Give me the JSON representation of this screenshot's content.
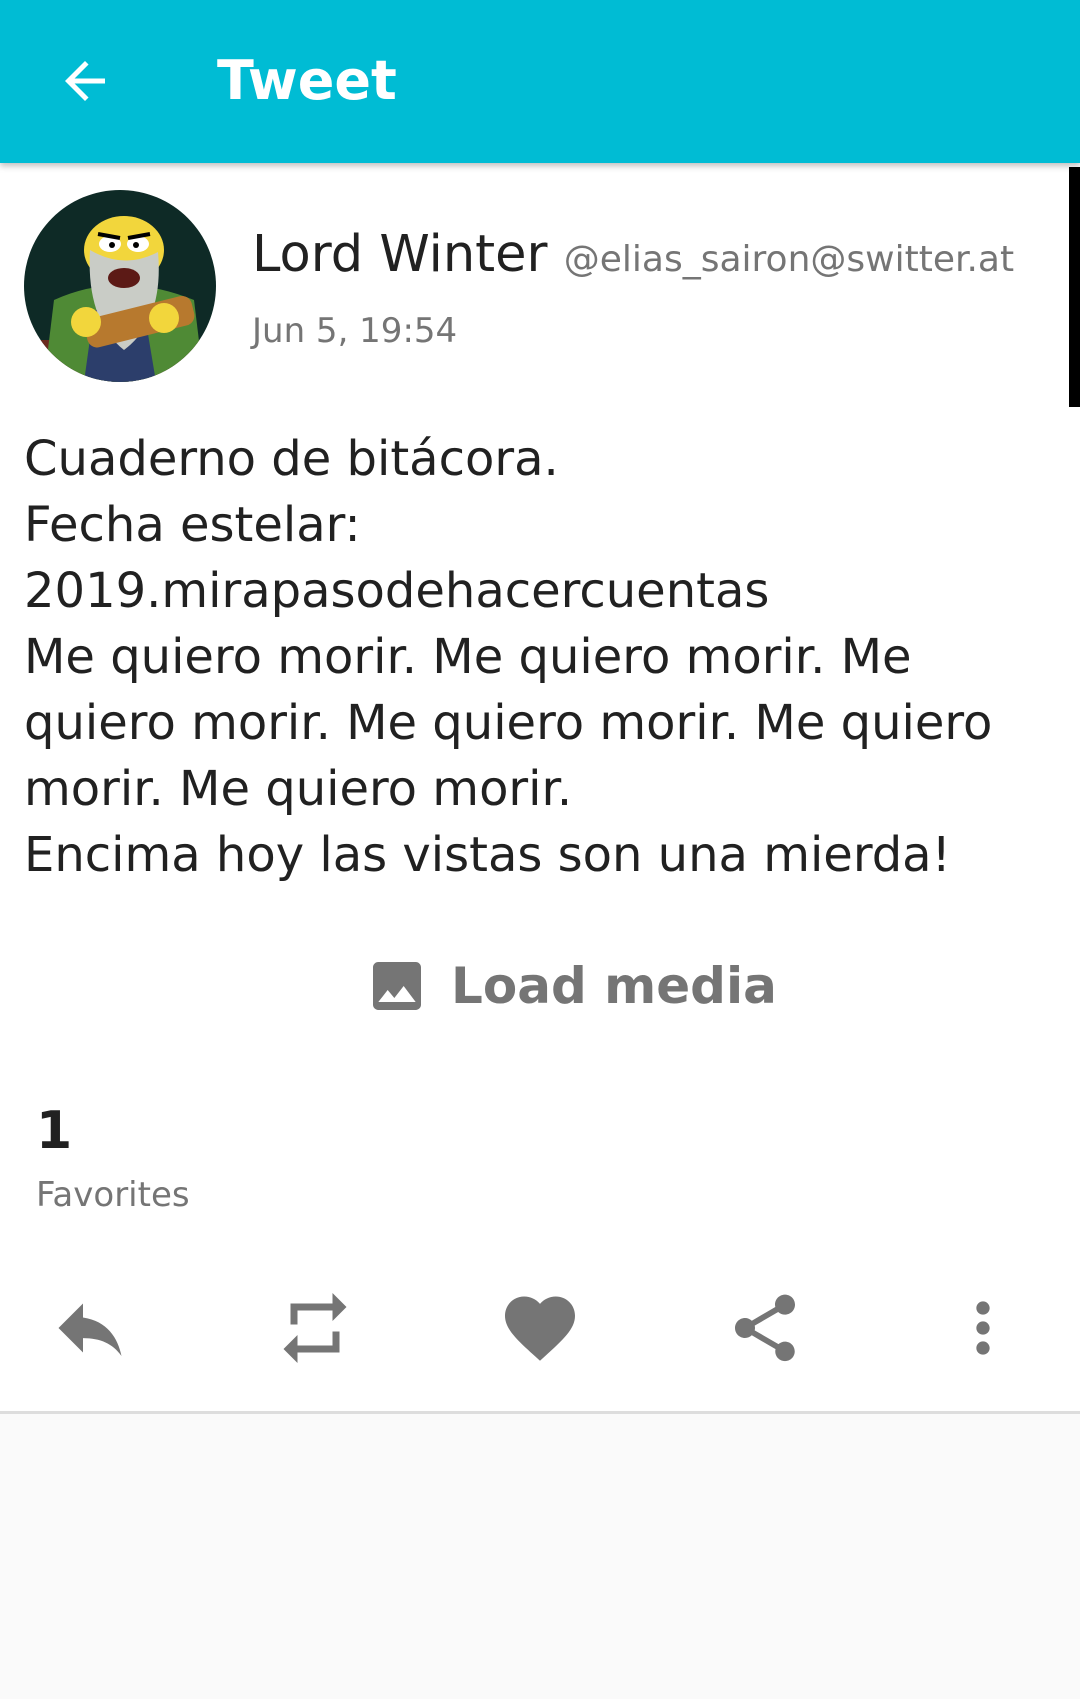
{
  "theme": {
    "accent": "#00bcd4",
    "icon_gray": "#757575"
  },
  "appbar": {
    "back_icon": "arrow-left-icon",
    "title": "Tweet"
  },
  "tweet": {
    "author": {
      "display_name": "Lord Winter",
      "handle": "@elias_sairon@switter.at",
      "avatar": "bearded-man-avatar"
    },
    "timestamp": "Jun 5, 19:54",
    "text_lines": [
      "Cuaderno de bitácora.",
      "Fecha estelar:",
      "2019.mirapasodehacercuentas",
      "Me quiero morir. Me quiero morir. Me",
      "quiero morir. Me quiero morir. Me quiero",
      "morir. Me quiero morir.",
      "Encima hoy las vistas son una mierda!"
    ],
    "load_media": {
      "icon": "image-icon",
      "label": "Load media"
    },
    "stats": {
      "favorites_count": "1",
      "favorites_label": "Favorites"
    },
    "actions": [
      {
        "name": "reply",
        "icon": "reply-icon"
      },
      {
        "name": "retweet",
        "icon": "retweet-icon"
      },
      {
        "name": "favorite",
        "icon": "heart-icon"
      },
      {
        "name": "share",
        "icon": "share-icon"
      },
      {
        "name": "more",
        "icon": "more-vertical-icon"
      }
    ]
  }
}
